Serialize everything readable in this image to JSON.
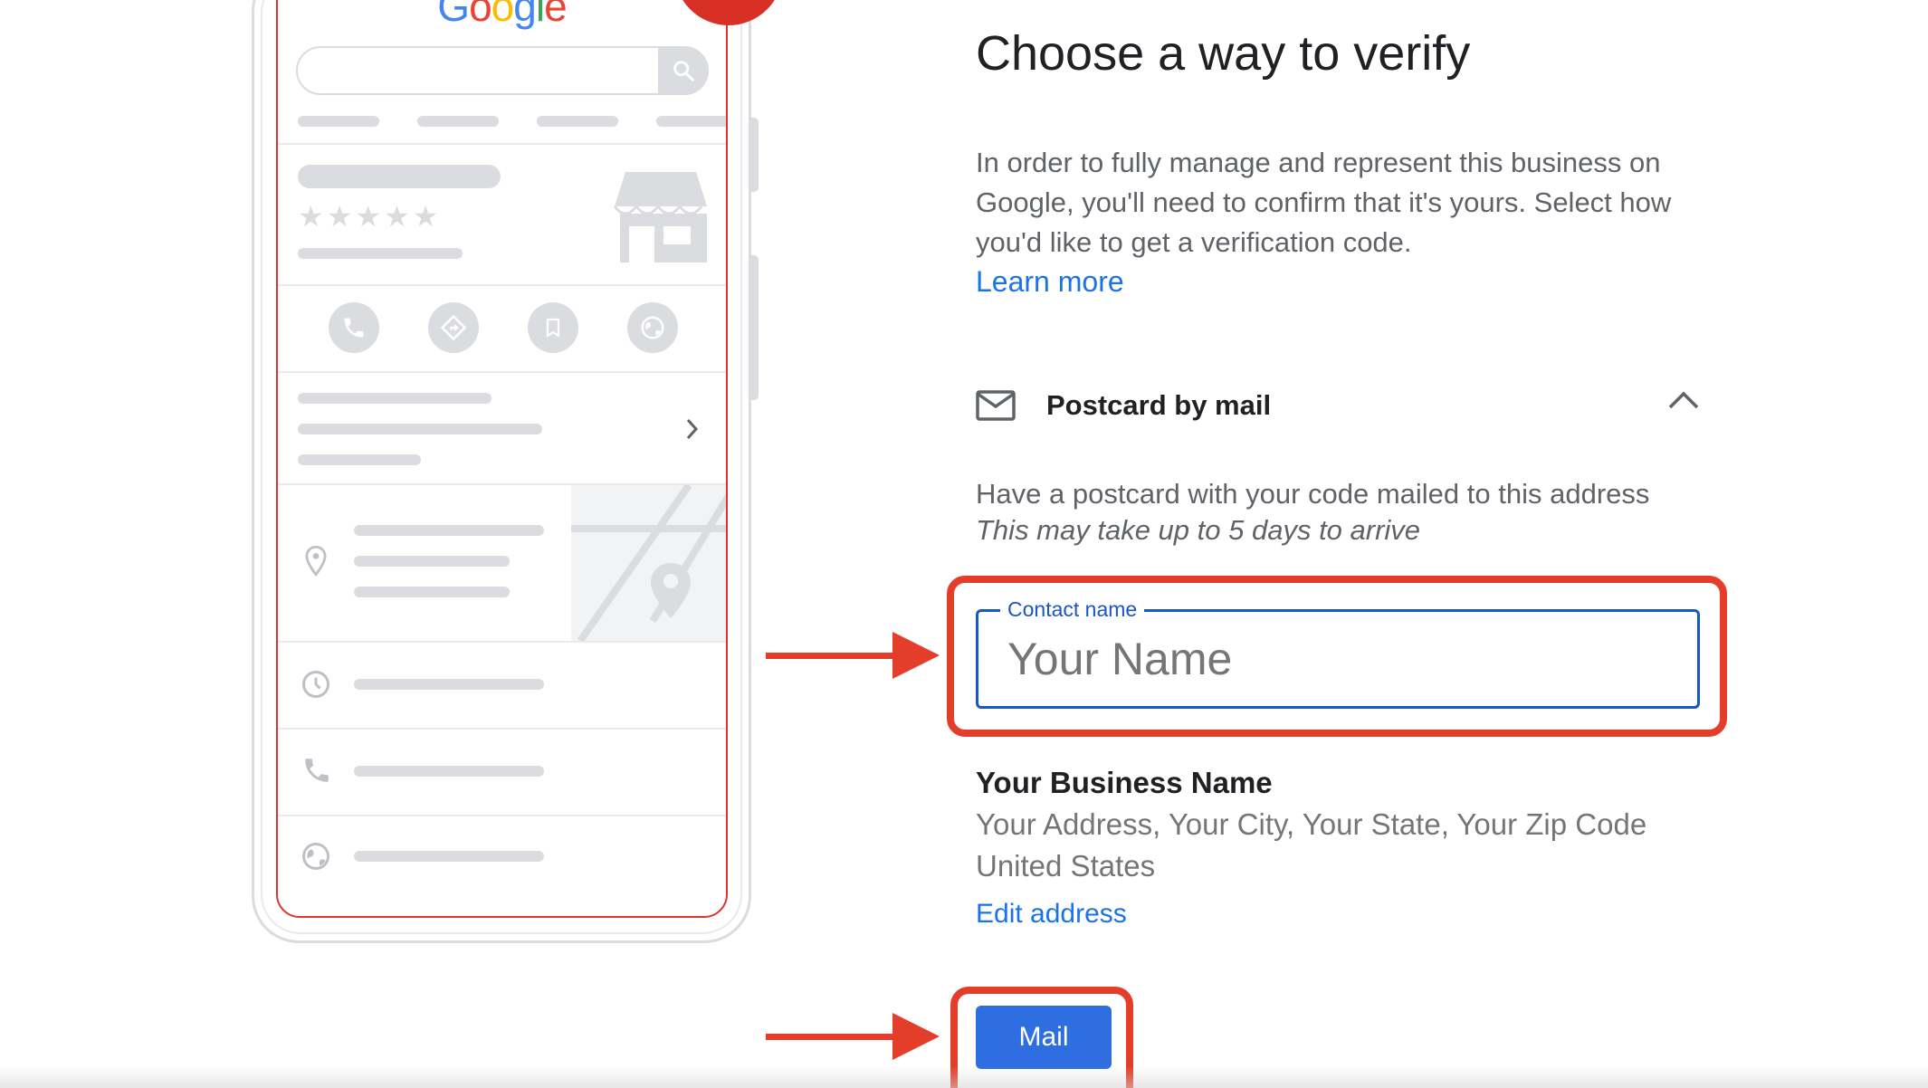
{
  "illustration": {
    "logo_letters": [
      "G",
      "o",
      "o",
      "g",
      "l",
      "e"
    ],
    "stars": "★★★★★",
    "action_icons": [
      "phone-icon",
      "directions-icon",
      "bookmark-icon",
      "globe-icon"
    ],
    "detail_icons": [
      "location-pin-icon",
      "clock-icon",
      "phone-icon",
      "globe-icon"
    ],
    "accent_color": "#d93025"
  },
  "page": {
    "title": "Choose a way to verify",
    "intro": "In order to fully manage and represent this business on Google, you'll need to confirm that it's yours. Select how you'd like to get a verification code.",
    "learn_more": "Learn more"
  },
  "option": {
    "icon": "mail-icon",
    "label": "Postcard by mail",
    "expanded": true,
    "description": "Have a postcard with your code mailed to this address",
    "note": "This may take up to 5 days to arrive"
  },
  "contact_field": {
    "label": "Contact name",
    "value": "",
    "placeholder": "Your Name"
  },
  "business": {
    "name": "Your Business Name",
    "address": "Your Address, Your City, Your State, Your Zip Code",
    "country": "United States",
    "edit_link": "Edit address"
  },
  "actions": {
    "mail_button": "Mail"
  },
  "colors": {
    "highlight": "#e43d2a",
    "primary": "#2f6ee0",
    "link": "#1a73e8"
  }
}
